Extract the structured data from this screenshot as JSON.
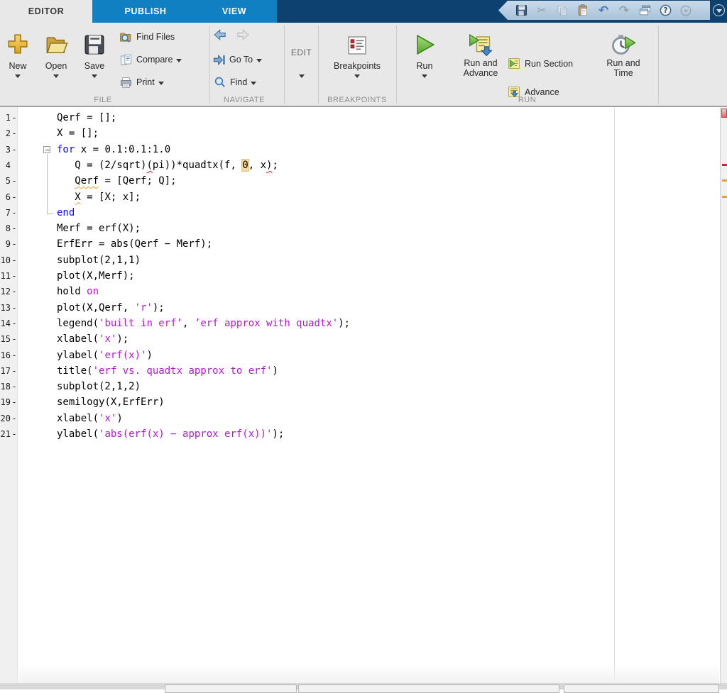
{
  "titlebar": {
    "tabs": {
      "editor": "EDITOR",
      "publish": "PUBLISH",
      "view": "VIEW"
    },
    "quick_access_icons": [
      "save-icon",
      "cut-icon",
      "copy-icon",
      "paste-icon",
      "undo-icon",
      "redo-icon",
      "windows-icon",
      "help-icon",
      "dropdown-icon"
    ],
    "window_menu_icon": "dropdown-circle-icon"
  },
  "toolstrip": {
    "file": {
      "label": "FILE",
      "new": "New",
      "open": "Open",
      "save": "Save",
      "find_files": "Find Files",
      "compare": "Compare",
      "print": "Print"
    },
    "navigate": {
      "label": "NAVIGATE",
      "go_to": "Go To",
      "find": "Find"
    },
    "edit": {
      "label": "EDIT"
    },
    "breakpoints": {
      "label": "BREAKPOINTS",
      "button": "Breakpoints"
    },
    "run": {
      "label": "RUN",
      "run": "Run",
      "run_and_advance_1": "Run and",
      "run_and_advance_2": "Advance",
      "run_section": "Run Section",
      "advance": "Advance",
      "run_and_time_1": "Run and",
      "run_and_time_2": "Time"
    }
  },
  "editor": {
    "code_lines": [
      {
        "num": "1",
        "dash": true,
        "fold": null,
        "segments": [
          [
            "p",
            "Qerf = [];"
          ]
        ]
      },
      {
        "num": "2",
        "dash": true,
        "fold": null,
        "segments": [
          [
            "p",
            "X = [];"
          ]
        ]
      },
      {
        "num": "3",
        "dash": true,
        "fold": "start",
        "segments": [
          [
            "k",
            "for"
          ],
          [
            "p",
            " x = 0.1:0.1:1.0"
          ]
        ]
      },
      {
        "num": "4",
        "dash": false,
        "fold": "mid",
        "segments": [
          [
            "p",
            "   Q = (2/sqrt)"
          ],
          [
            "es",
            "("
          ],
          [
            "p",
            "pi))*quadtx(f, "
          ],
          [
            "hl",
            "0"
          ],
          [
            "p",
            ", x"
          ],
          [
            "es",
            ")"
          ],
          [
            "p",
            ";"
          ]
        ]
      },
      {
        "num": "5",
        "dash": true,
        "fold": "mid",
        "segments": [
          [
            "p",
            "   "
          ],
          [
            "ws",
            "Qerf"
          ],
          [
            "p",
            " = [Qerf; Q];"
          ]
        ]
      },
      {
        "num": "6",
        "dash": true,
        "fold": "mid",
        "segments": [
          [
            "p",
            "   "
          ],
          [
            "ws",
            "X"
          ],
          [
            "p",
            " = [X; x];"
          ]
        ]
      },
      {
        "num": "7",
        "dash": true,
        "fold": "end",
        "segments": [
          [
            "k",
            "end"
          ]
        ]
      },
      {
        "num": "8",
        "dash": true,
        "fold": null,
        "segments": [
          [
            "p",
            "Merf = erf(X);"
          ]
        ]
      },
      {
        "num": "9",
        "dash": true,
        "fold": null,
        "segments": [
          [
            "p",
            "ErfErr = abs(Qerf − Merf);"
          ]
        ]
      },
      {
        "num": "10",
        "dash": true,
        "fold": null,
        "segments": [
          [
            "p",
            "subplot(2,1,1)"
          ]
        ]
      },
      {
        "num": "11",
        "dash": true,
        "fold": null,
        "segments": [
          [
            "p",
            "plot(X,Merf);"
          ]
        ]
      },
      {
        "num": "12",
        "dash": true,
        "fold": null,
        "segments": [
          [
            "p",
            "hold "
          ],
          [
            "s",
            "on"
          ]
        ]
      },
      {
        "num": "13",
        "dash": true,
        "fold": null,
        "segments": [
          [
            "p",
            "plot(X,Qerf, "
          ],
          [
            "s",
            "'r'"
          ],
          [
            "p",
            ");"
          ]
        ]
      },
      {
        "num": "14",
        "dash": true,
        "fold": null,
        "segments": [
          [
            "p",
            "legend("
          ],
          [
            "s",
            "'built in erf’"
          ],
          [
            "p",
            ", "
          ],
          [
            "s",
            "’erf approx with quadtx'"
          ],
          [
            "p",
            ");"
          ]
        ]
      },
      {
        "num": "15",
        "dash": true,
        "fold": null,
        "segments": [
          [
            "p",
            "xlabel("
          ],
          [
            "s",
            "'x'"
          ],
          [
            "p",
            ");"
          ]
        ]
      },
      {
        "num": "16",
        "dash": true,
        "fold": null,
        "segments": [
          [
            "p",
            "ylabel("
          ],
          [
            "s",
            "'erf(x)'"
          ],
          [
            "p",
            ")"
          ]
        ]
      },
      {
        "num": "17",
        "dash": true,
        "fold": null,
        "segments": [
          [
            "p",
            "title("
          ],
          [
            "s",
            "'erf vs. quadtx approx to erf'"
          ],
          [
            "p",
            ")"
          ]
        ]
      },
      {
        "num": "18",
        "dash": true,
        "fold": null,
        "segments": [
          [
            "p",
            "subplot(2,1,2)"
          ]
        ]
      },
      {
        "num": "19",
        "dash": true,
        "fold": null,
        "segments": [
          [
            "p",
            "semilogy(X,ErfErr)"
          ]
        ]
      },
      {
        "num": "20",
        "dash": true,
        "fold": null,
        "segments": [
          [
            "p",
            "xlabel("
          ],
          [
            "s",
            "'x'"
          ],
          [
            "p",
            ")"
          ]
        ]
      },
      {
        "num": "21",
        "dash": true,
        "fold": null,
        "segments": [
          [
            "p",
            "ylabel("
          ],
          [
            "s",
            "'abs(erf(x) − approx erf(x))'"
          ],
          [
            "p",
            ");"
          ]
        ]
      }
    ],
    "annotations": {
      "indicator": "errors-present",
      "marks": [
        {
          "type": "error",
          "line": 4
        },
        {
          "type": "warning",
          "line": 5
        },
        {
          "type": "warning",
          "line": 6
        }
      ]
    }
  },
  "colors": {
    "keyword": "#0D0DFF",
    "string": "#B218D2",
    "error_mark": "#DD2222",
    "warning_mark": "#F0A030",
    "highlight_bg": "#F0D9A6",
    "tab_blue": "#1080C2",
    "titlebar_navy": "#0D4170",
    "toolstrip_bg": "#E8E8E8"
  }
}
